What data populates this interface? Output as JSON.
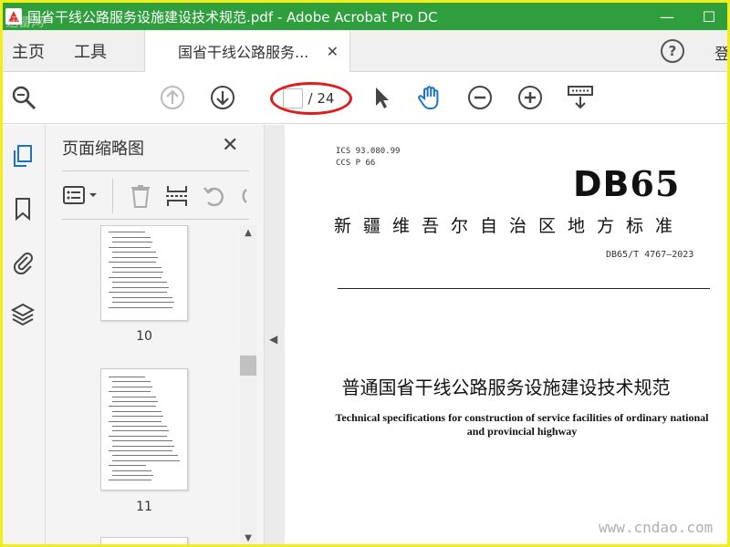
{
  "window": {
    "title": "国省干线公路服务设施建设技术规范.pdf - Adobe Acrobat Pro DC",
    "watermark": "迅雷网",
    "minimize_glyph": "—",
    "maximize_glyph": "☐"
  },
  "tabs": {
    "home": "主页",
    "tools": "工具",
    "doc_tab": "国省干线公路服务...",
    "close_glyph": "✕",
    "help_glyph": "?",
    "login": "登"
  },
  "toolbar": {
    "page_total": "/ 24",
    "icons": [
      "search-zoom-icon",
      "prev-page-icon",
      "next-page-icon",
      "select-cursor-icon",
      "hand-tool-icon",
      "zoom-out-icon",
      "zoom-in-icon",
      "keyboard-scroll-icon"
    ]
  },
  "panel": {
    "title": "页面缩略图",
    "close_glyph": "✕",
    "thumbnails": [
      {
        "number": "10"
      },
      {
        "number": "11"
      }
    ]
  },
  "document": {
    "ics": "ICS  93.080.99",
    "ccs": "CCS  P 66",
    "logo_db": "DB",
    "logo_num": "65",
    "standard_title": "新疆维吾尔自治区地方标准",
    "standard_number": "DB65/T 4767—2023",
    "cn_title": "普通国省干线公路服务设施建设技术规范",
    "en_title": "Technical specifications for construction of service facilities of ordinary national and provincial highway",
    "watermark": "www.cndao.com"
  },
  "colors": {
    "titlebar": "#2f9e3d",
    "frame": "#f2ee1c",
    "accent_blue": "#1a73c9",
    "highlight_red": "#e01b1b"
  }
}
